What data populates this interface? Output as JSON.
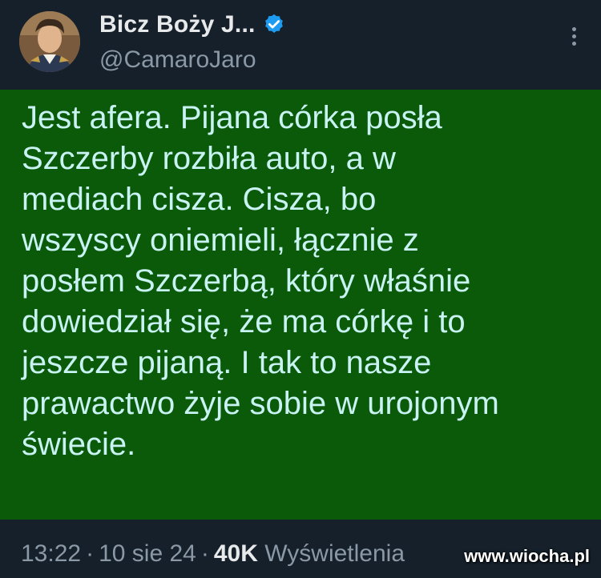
{
  "author": {
    "display_name": "Bicz Boży J...",
    "handle": "@CamaroJaro",
    "verified_icon": "verified-badge-icon",
    "avatar_icon": "profile-avatar"
  },
  "post": {
    "text": "Jest afera. Pijana córka posła\nSzczerby rozbiła auto, a w\nmediach cisza. Cisza, bo\nwszyscy oniemieli, łącznie z\nposłem Szczerbą, który właśnie\ndowiedział się, że ma córkę i to\njeszcze pijaną. I tak to nasze\nprawactwo żyje sobie w urojonym\nświecie.",
    "background": "#0a5a0a",
    "text_color": "#c9f2f2"
  },
  "meta": {
    "time": "13:22",
    "date": "10 sie 24",
    "views_count": "40K",
    "views_label": "Wyświetlenia",
    "separator": "·"
  },
  "watermark": "www.wiocha.pl",
  "colors": {
    "app_background": "#15202b",
    "secondary_text": "#8b98a5",
    "verified_blue": "#1d9bf0"
  }
}
